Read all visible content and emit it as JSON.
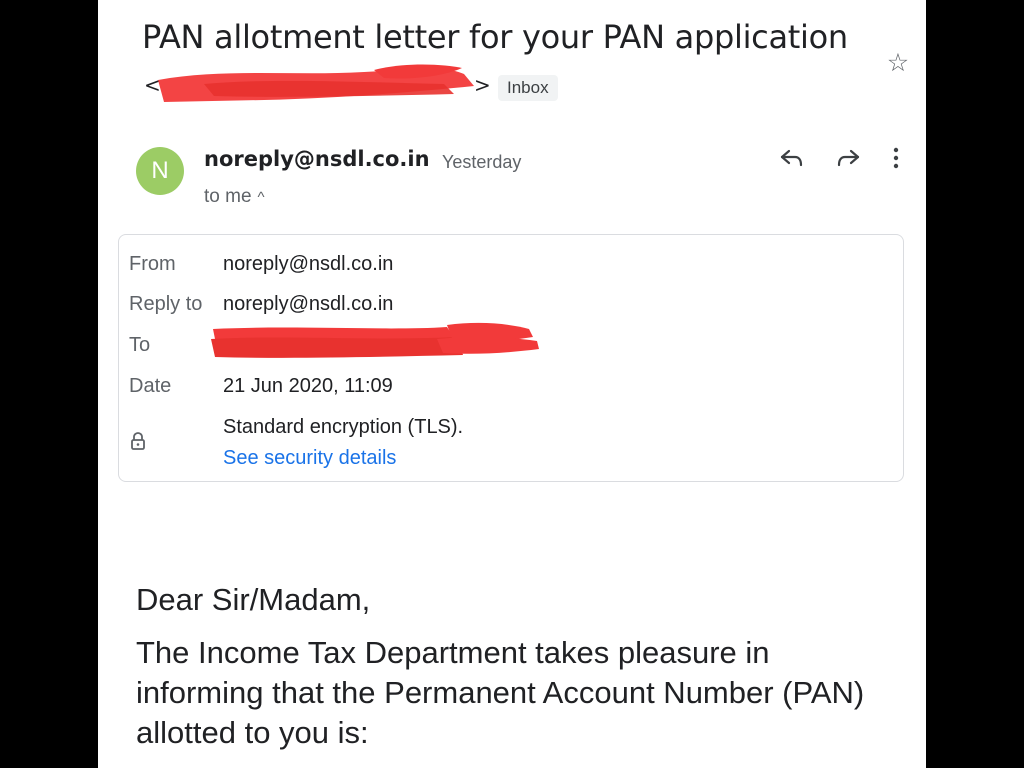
{
  "email": {
    "subject": "PAN allotment letter for your PAN application",
    "label": "Inbox",
    "avatar_letter": "N",
    "sender": "noreply@nsdl.co.in",
    "time": "Yesterday",
    "recipient_summary": "to me",
    "caret": "^"
  },
  "details": {
    "from_label": "From",
    "from_value": "noreply@nsdl.co.in",
    "reply_to_label": "Reply to",
    "reply_to_value": "noreply@nsdl.co.in",
    "to_label": "To",
    "date_label": "Date",
    "date_value": "21 Jun 2020, 11:09",
    "encryption": "Standard encryption (TLS).",
    "security_link": "See security details"
  },
  "body": {
    "greeting": "Dear Sir/Madam,",
    "paragraph": "The Income Tax Department takes pleasure in informing that the Permanent Account Number (PAN) allotted to you is:"
  },
  "icons": {
    "star": "star-outline-icon",
    "reply": "reply-icon",
    "forward": "forward-icon",
    "more": "more-vert-icon",
    "lock": "lock-icon"
  },
  "colors": {
    "avatar": "#9ccc65",
    "link": "#1a73e8",
    "redaction": "#f23a3a"
  }
}
